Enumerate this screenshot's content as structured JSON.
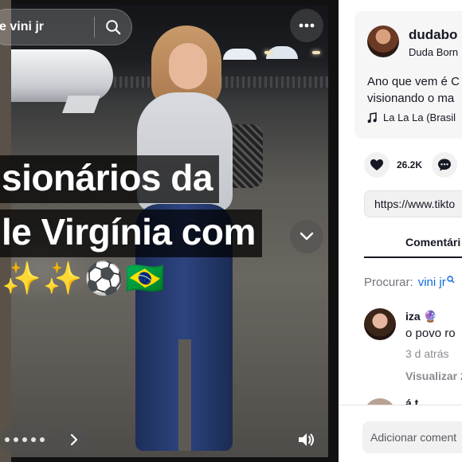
{
  "video": {
    "search_query": "e vini jr",
    "caption_line1": "sionários da",
    "caption_line2": "le Virgínia com",
    "caption_emojis": "✨✨⚽🇧🇷"
  },
  "post": {
    "username": "dudabo",
    "nickname": "Duda Born",
    "description": "Ano que vem é C visionando o ma",
    "music": "La La La (Brasil",
    "like_count": "26.2K",
    "share_link": "https://www.tikto"
  },
  "comments_tab": {
    "label": "Comentári",
    "search_label": "Procurar:",
    "search_value": "vini jr"
  },
  "comments": [
    {
      "username": "iza 🔮",
      "text": "o povo ro",
      "time": "3 d atrás",
      "view_replies": "Visualizar 2"
    },
    {
      "username": "á t",
      "text": "",
      "time": "",
      "view_replies": ""
    }
  ],
  "footer": {
    "add_comment_placeholder": "Adicionar coment"
  },
  "icons": {
    "search": "search-icon",
    "more": "more-icon",
    "chevron_down": "chevron-down-icon",
    "chevron_right": "chevron-right-icon",
    "volume": "volume-icon",
    "heart": "heart-icon",
    "comment": "comment-icon",
    "music_note": "music-note-icon"
  }
}
